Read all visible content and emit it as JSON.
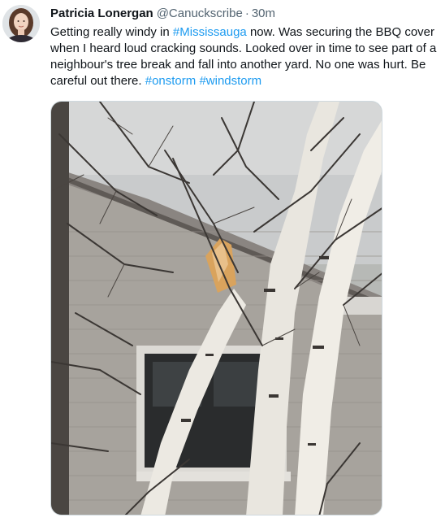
{
  "tweet": {
    "author": {
      "display_name": "Patricia Lonergan",
      "handle": "@Canuckscribe",
      "separator": "·",
      "time": "30m"
    },
    "text_parts": {
      "p1": "Getting really windy in ",
      "link1": "#Mississauga",
      "p2": " now. Was securing the BBQ cover when I heard loud cracking sounds. Looked over in time to see part of a neighbour's tree break and fall into another yard. No one was hurt. Be careful out there. ",
      "tag1": "#onstorm",
      "space": " ",
      "tag2": "#windstorm"
    },
    "colors": {
      "link": "#1d9bf0",
      "secondary_text": "#536471",
      "primary_text": "#0f1419"
    },
    "icons": {
      "avatar": "profile-photo",
      "media": "photo-broken-birch-tree-near-house"
    }
  }
}
